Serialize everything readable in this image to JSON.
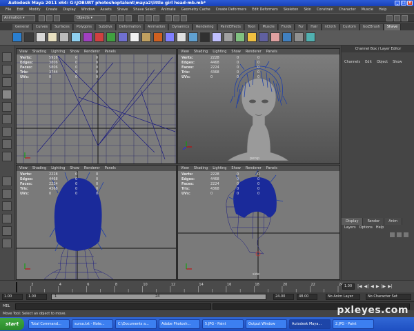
{
  "window": {
    "title": "Autodesk Maya 2011 x64: G:\\JOBURT photoshoptalent\\maya2\\little girl head-mb.mb*"
  },
  "menubar": [
    "File",
    "Edit",
    "Modify",
    "Create",
    "Display",
    "Window",
    "Assets",
    "Shave",
    "Shave Select",
    "Animate",
    "Geometry Cache",
    "Create Deformers",
    "Edit Deformers",
    "Skeleton",
    "Skin",
    "Constrain",
    "Character",
    "Muscle",
    "Help"
  ],
  "statusline": {
    "menuset": "Animation",
    "selection_mode": "Objects"
  },
  "shelf_tabs": [
    "General",
    "Curves",
    "Surfaces",
    "Polygons",
    "Subdivs",
    "Deformation",
    "Animation",
    "Dynamics",
    "Rendering",
    "PaintEffects",
    "Toon",
    "Muscle",
    "Fluids",
    "Fur",
    "Hair",
    "nCloth",
    "Custom",
    "GoZBrush",
    "Shave"
  ],
  "shelf_active_tab": "Shave",
  "viewport_menu": [
    "View",
    "Shading",
    "Lighting",
    "Show",
    "Renderer",
    "Panels"
  ],
  "viewports": [
    {
      "id": "top",
      "hud": [
        [
          "Verts:",
          "5916",
          "0",
          "0"
        ],
        [
          "Edges:",
          "3806",
          "0",
          "0"
        ],
        [
          "Faces:",
          "5806",
          "0",
          "0"
        ],
        [
          "Tris:",
          "3744",
          "0",
          "0"
        ],
        [
          "UVs:",
          "0",
          "0",
          "0"
        ]
      ],
      "camera": ""
    },
    {
      "id": "persp",
      "hud": [
        [
          "Verts:",
          "2228",
          "0",
          "0"
        ],
        [
          "Edges:",
          "4468",
          "0",
          "0"
        ],
        [
          "Faces:",
          "2224",
          "0",
          "0"
        ],
        [
          "Tris:",
          "4368",
          "0",
          "0"
        ],
        [
          "UVs:",
          "0",
          "0",
          "0"
        ]
      ],
      "camera": "persp"
    },
    {
      "id": "front",
      "hud": [
        [
          "Verts:",
          "2228",
          "0",
          "0"
        ],
        [
          "Edges:",
          "4468",
          "0",
          "0"
        ],
        [
          "Faces:",
          "2224",
          "0",
          "0"
        ],
        [
          "Tris:",
          "4368",
          "0",
          "0"
        ],
        [
          "UVs:",
          "0",
          "0",
          "0"
        ]
      ],
      "camera": ""
    },
    {
      "id": "side",
      "hud": [
        [
          "Verts:",
          "2228",
          "0",
          "0"
        ],
        [
          "Edges:",
          "4468",
          "0",
          "0"
        ],
        [
          "Faces:",
          "2224",
          "0",
          "0"
        ],
        [
          "Tris:",
          "4368",
          "0",
          "0"
        ],
        [
          "UVs:",
          "0",
          "0",
          "0"
        ]
      ],
      "camera": "side"
    }
  ],
  "channelbox": {
    "header": "Channel Box / Layer Editor",
    "menu": [
      "Channels",
      "Edit",
      "Object",
      "Show"
    ],
    "layer_tabs": [
      "Display",
      "Render",
      "Anim"
    ],
    "layer_active_tab": "Display",
    "layer_menu": [
      "Layers",
      "Options",
      "Help"
    ]
  },
  "timeslider": {
    "ticks": [
      "2",
      "4",
      "6",
      "8",
      "10",
      "12",
      "14",
      "16",
      "18",
      "20",
      "22",
      "24"
    ],
    "current_frame": "1.00"
  },
  "range": {
    "start": "1.00",
    "inner_start": "1.00",
    "inner_start_value": "1",
    "inner_end_value": "24",
    "inner_end": "24.00",
    "end": "48.00",
    "anim_layer": "No Anim Layer",
    "character_set": "No Character Set"
  },
  "cmdline": {
    "label": "MEL"
  },
  "helpline": "Move Tool: Select an object to move.",
  "taskbar": {
    "start": "start",
    "items": [
      "Total Command...",
      "sursa.txt - Note...",
      "C:\\Documents a...",
      "Adobe Photosh...",
      "5.JPG - Paint",
      "Output Window",
      "Autodesk Maya...",
      "2.JPG - Paint"
    ],
    "active_index": 6
  },
  "watermark": "pxleyes.com",
  "colors": {
    "hair": "#1e3fa8",
    "wire": "#1a1a80",
    "grid": "#3b3b6a",
    "accent": "#2b5bd6"
  }
}
